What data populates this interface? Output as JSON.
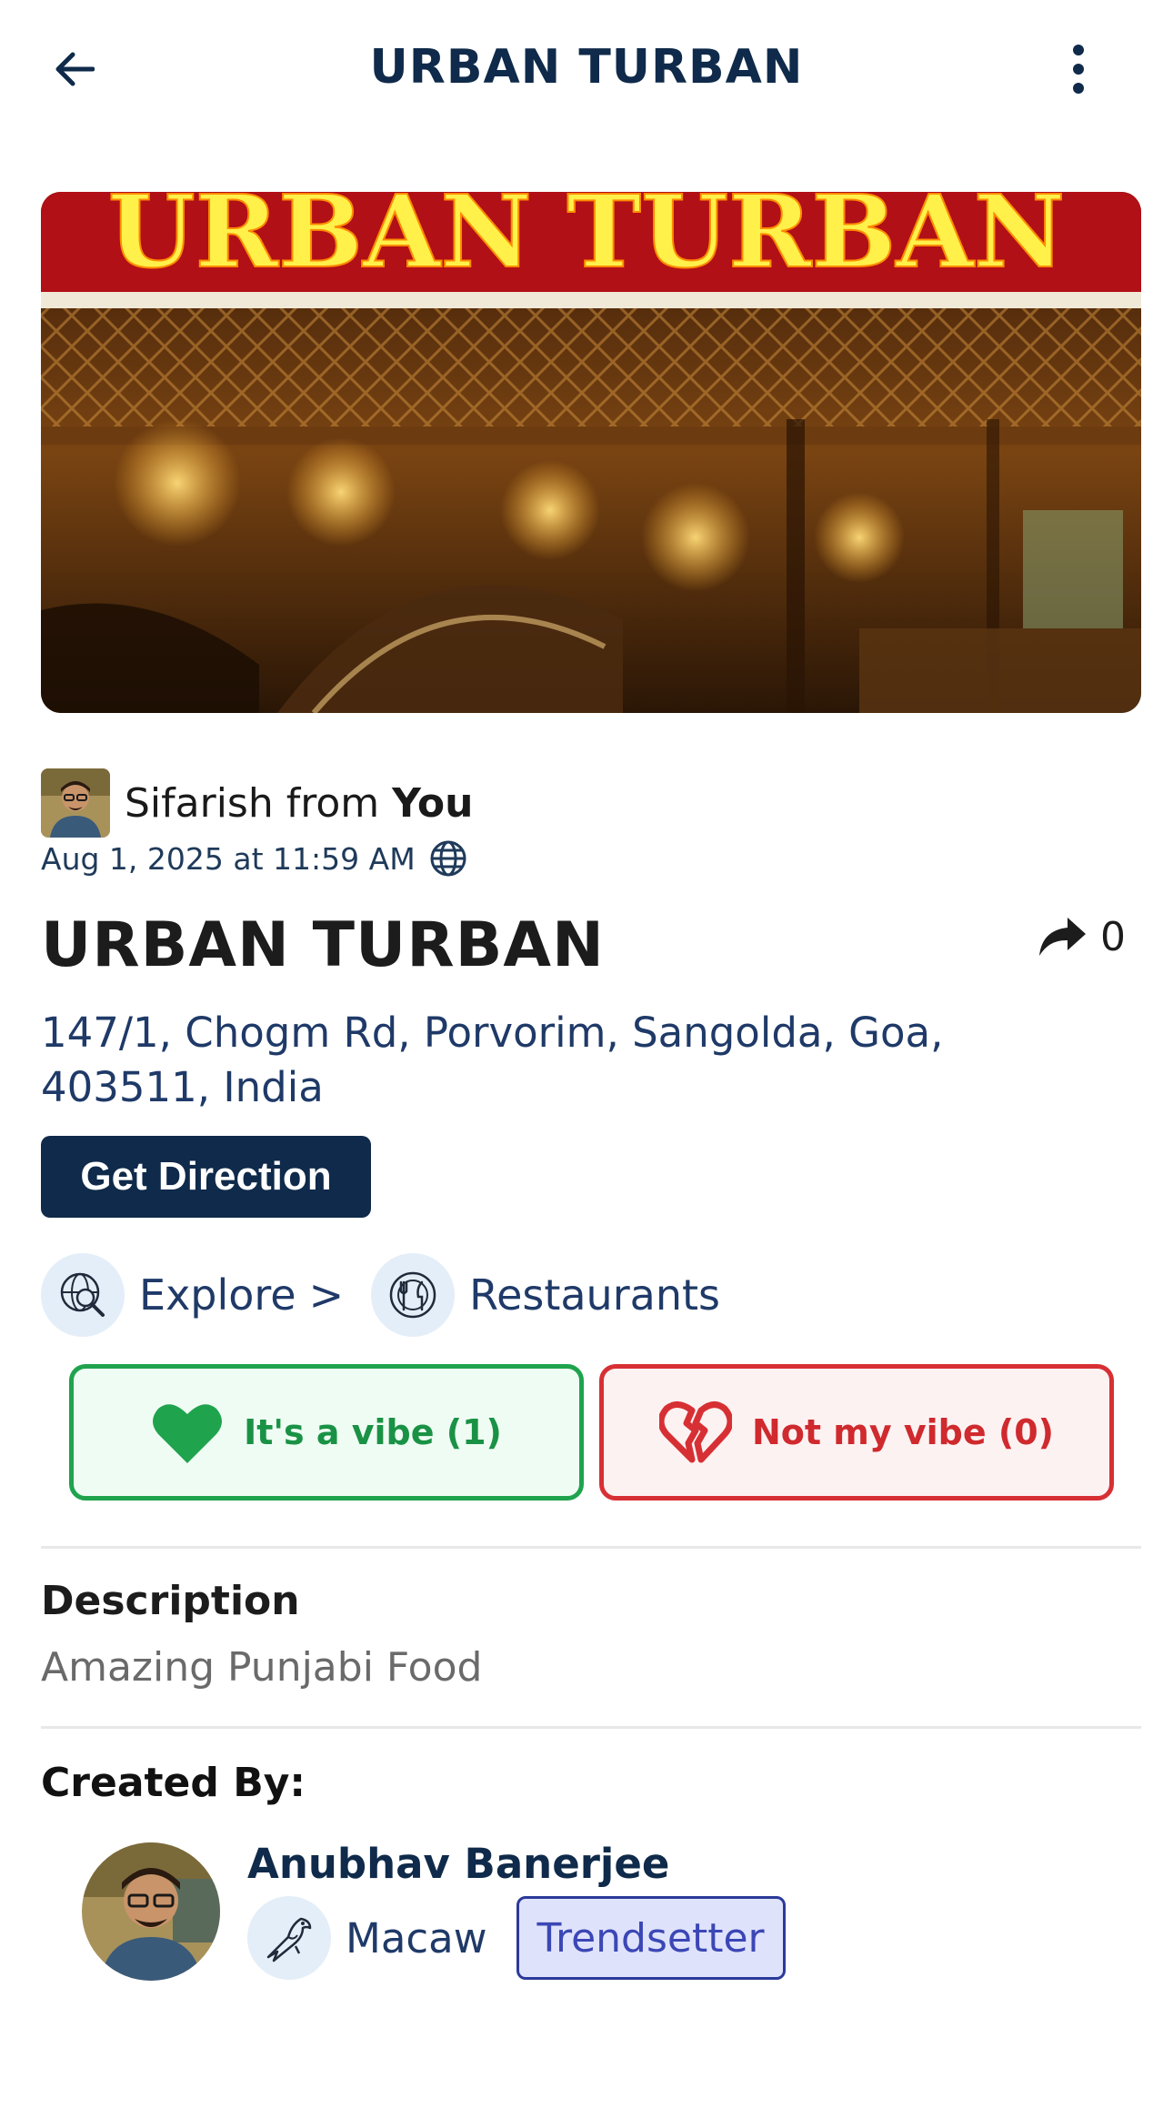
{
  "header": {
    "title": "URBAN TURBAN",
    "back_icon": "arrow-left-icon",
    "more_icon": "more-vertical-icon"
  },
  "hero": {
    "sign_text": "URBAN TURBAN"
  },
  "sifarish": {
    "prefix": "Sifarish from ",
    "who": "You",
    "timestamp": "Aug 1, 2025 at 11:59 AM",
    "visibility_icon": "globe-icon"
  },
  "place": {
    "name": "URBAN TURBAN",
    "share_count": "0",
    "address": "147/1, Chogm Rd, Porvorim, Sangolda, Goa, 403511, India",
    "direction_label": "Get Direction"
  },
  "breadcrumb": {
    "items": [
      {
        "label": "Explore",
        "icon": "explore-globe-icon"
      },
      {
        "label": "Restaurants",
        "icon": "restaurant-icon"
      }
    ],
    "separator": ">"
  },
  "vibes": {
    "positive_label": "It's a vibe (1)",
    "negative_label": "Not my vibe (0)"
  },
  "description": {
    "heading": "Description",
    "text": "Amazing Punjabi Food"
  },
  "created_by": {
    "heading": "Created By:",
    "name": "Anubhav Banerjee",
    "rank": "Macaw",
    "badge": "Trendsetter"
  },
  "colors": {
    "primary_navy": "#0f2a4a",
    "vibe_green": "#1fa34d",
    "vibe_red": "#d73034",
    "badge_purple": "#3b47b5"
  }
}
